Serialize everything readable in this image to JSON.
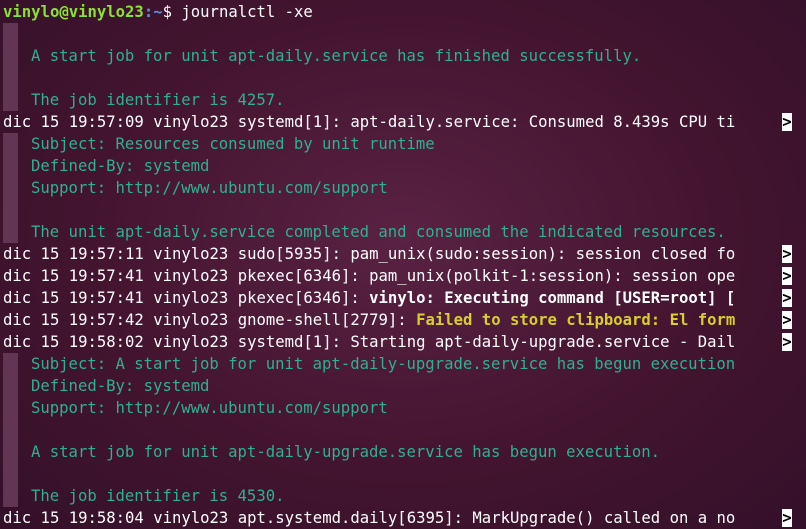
{
  "prompt": {
    "user_host": "vinylo@vinylo23",
    "path": ":~",
    "symbol": "$",
    "command": " journalctl -xe"
  },
  "truncation_marker": ">",
  "lines": {
    "l1": "",
    "l2": "A start job for unit apt-daily.service has finished successfully.",
    "l3": "",
    "l4": "The job identifier is 4257.",
    "l5": "dic 15 19:57:09 vinylo23 systemd[1]: apt-daily.service: Consumed 8.439s CPU ti",
    "l6": "Subject: Resources consumed by unit runtime",
    "l7": "Defined-By: systemd",
    "l8": "Support: http://www.ubuntu.com/support",
    "l9": "",
    "l10": "The unit apt-daily.service completed and consumed the indicated resources.",
    "l11": "dic 15 19:57:11 vinylo23 sudo[5935]: pam_unix(sudo:session): session closed fo",
    "l12": "dic 15 19:57:41 vinylo23 pkexec[6346]: pam_unix(polkit-1:session): session ope",
    "l13_prefix": "dic 15 19:57:41 vinylo23 pkexec[6346]: ",
    "l13_bold": "vinylo: Executing command [USER=root] [",
    "l14_prefix": "dic 15 19:57:42 vinylo23 gnome-shell[2779]: ",
    "l14_warn": "Failed to store clipboard: El form",
    "l15": "dic 15 19:58:02 vinylo23 systemd[1]: Starting apt-daily-upgrade.service - Dail",
    "l16": "Subject: A start job for unit apt-daily-upgrade.service has begun execution",
    "l17": "Defined-By: systemd",
    "l18": "Support: http://www.ubuntu.com/support",
    "l19": "",
    "l20": "A start job for unit apt-daily-upgrade.service has begun execution.",
    "l21": "",
    "l22": "The job identifier is 4530.",
    "l23": "dic 15 19:58:04 vinylo23 apt.systemd.daily[6395]: MarkUpgrade() called on a no"
  }
}
